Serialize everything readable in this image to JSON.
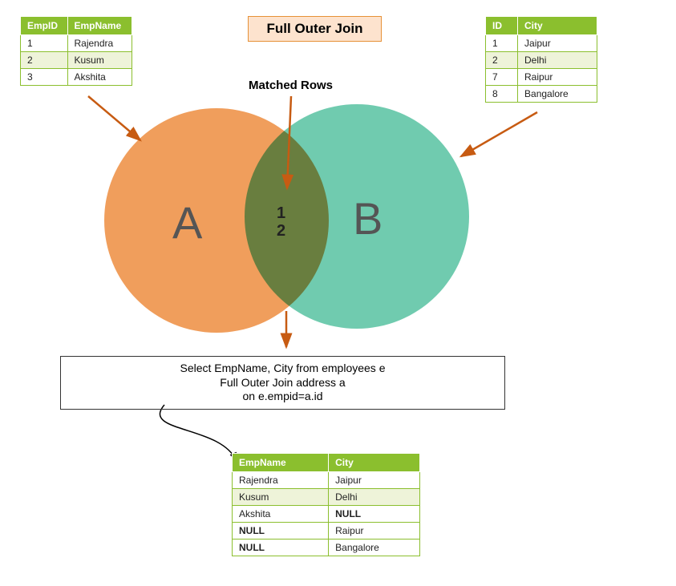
{
  "title": "Full Outer Join",
  "matched_label": "Matched Rows",
  "venn": {
    "labelA": "A",
    "labelB": "B",
    "overlap": [
      "1",
      "2"
    ]
  },
  "employees": {
    "headers": [
      "EmpID",
      "EmpName"
    ],
    "rows": [
      [
        "1",
        "Rajendra"
      ],
      [
        "2",
        "Kusum"
      ],
      [
        "3",
        "Akshita"
      ]
    ]
  },
  "address": {
    "headers": [
      "ID",
      "City"
    ],
    "rows": [
      [
        "1",
        "Jaipur"
      ],
      [
        "2",
        "Delhi"
      ],
      [
        "7",
        "Raipur"
      ],
      [
        "8",
        "Bangalore"
      ]
    ]
  },
  "sql": {
    "line1": "Select EmpName, City from employees e",
    "line2": "Full Outer Join address a",
    "line3": "on e.empid=a.id"
  },
  "result": {
    "headers": [
      "EmpName",
      "City"
    ],
    "rows": [
      {
        "emp": "Rajendra",
        "city": "Jaipur",
        "emp_null": false,
        "city_null": false
      },
      {
        "emp": "Kusum",
        "city": "Delhi",
        "emp_null": false,
        "city_null": false
      },
      {
        "emp": "Akshita",
        "city": "NULL",
        "emp_null": false,
        "city_null": true
      },
      {
        "emp": "NULL",
        "city": "Raipur",
        "emp_null": true,
        "city_null": false
      },
      {
        "emp": "NULL",
        "city": "Bangalore",
        "emp_null": true,
        "city_null": false
      }
    ]
  }
}
